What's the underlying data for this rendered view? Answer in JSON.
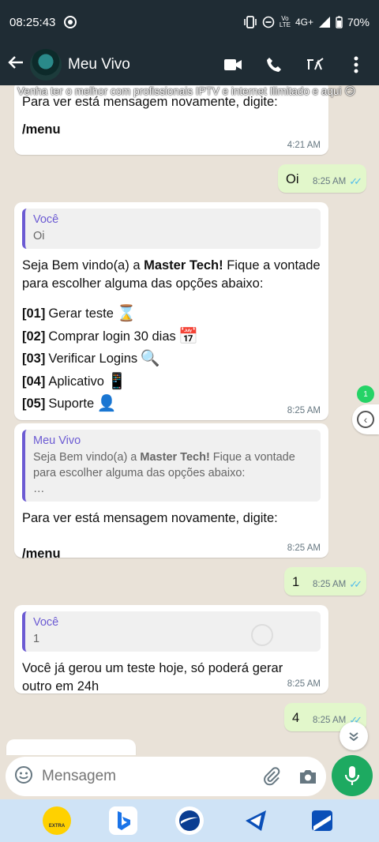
{
  "status": {
    "time": "08:25:43",
    "network": "4G+",
    "battery": "70%"
  },
  "header": {
    "contact_name": "Meu Vivo"
  },
  "banner": {
    "text": "Venha ter o melhor com profissionais IPTV e internet Ilimitado e aqui 😏"
  },
  "messages": {
    "m1": {
      "text": "Para ver está mensagem novamente, digite:",
      "cmd": "/menu",
      "time": "4:21 AM"
    },
    "m2": {
      "text": "Oi",
      "time": "8:25 AM"
    },
    "m3": {
      "quote_name": "Você",
      "quote_text": "Oi",
      "intro_a": "Seja Bem vindo(a) a ",
      "intro_bold": "Master Tech!",
      "intro_b": " Fique a vontade para escolher alguma das opções abaixo:",
      "options": [
        {
          "code": "[01]",
          "label": "Gerar teste",
          "emoji": "⌛"
        },
        {
          "code": "[02]",
          "label": "Comprar login 30 dias",
          "emoji": "📅"
        },
        {
          "code": "[03]",
          "label": "Verificar Logins",
          "emoji": "🔍"
        },
        {
          "code": "[04]",
          "label": "Aplicativo",
          "emoji": "📱"
        },
        {
          "code": "[05]",
          "label": "Suporte",
          "emoji": "👤"
        }
      ],
      "time": "8:25 AM"
    },
    "m4": {
      "quote_name": "Meu Vivo",
      "quote_a": "Seja Bem vindo(a) a ",
      "quote_bold": "Master Tech!",
      "quote_b": " Fique a vontade para escolher alguma das opções abaixo:",
      "quote_more": "…",
      "text": "Para ver está mensagem novamente, digite:",
      "cmd": "/menu",
      "time": "8:25 AM"
    },
    "m5": {
      "text": "1",
      "time": "8:25 AM"
    },
    "m6": {
      "quote_name": "Você",
      "quote_text": "1",
      "text": "Você já gerou um teste hoje, só poderá gerar outro em 24h",
      "time": "8:25 AM"
    },
    "m7": {
      "text": "4",
      "time": "8:25 AM"
    }
  },
  "unread_badge": "1",
  "composer": {
    "placeholder": "Mensagem"
  },
  "taskbar": {
    "extra_label": "EXTRA"
  },
  "colors": {
    "bar": "#1f2c34",
    "accent": "#1daa61",
    "quote": "#6c5bd3",
    "outgoing": "#e2f7cb",
    "ticks": "#53bdeb"
  }
}
